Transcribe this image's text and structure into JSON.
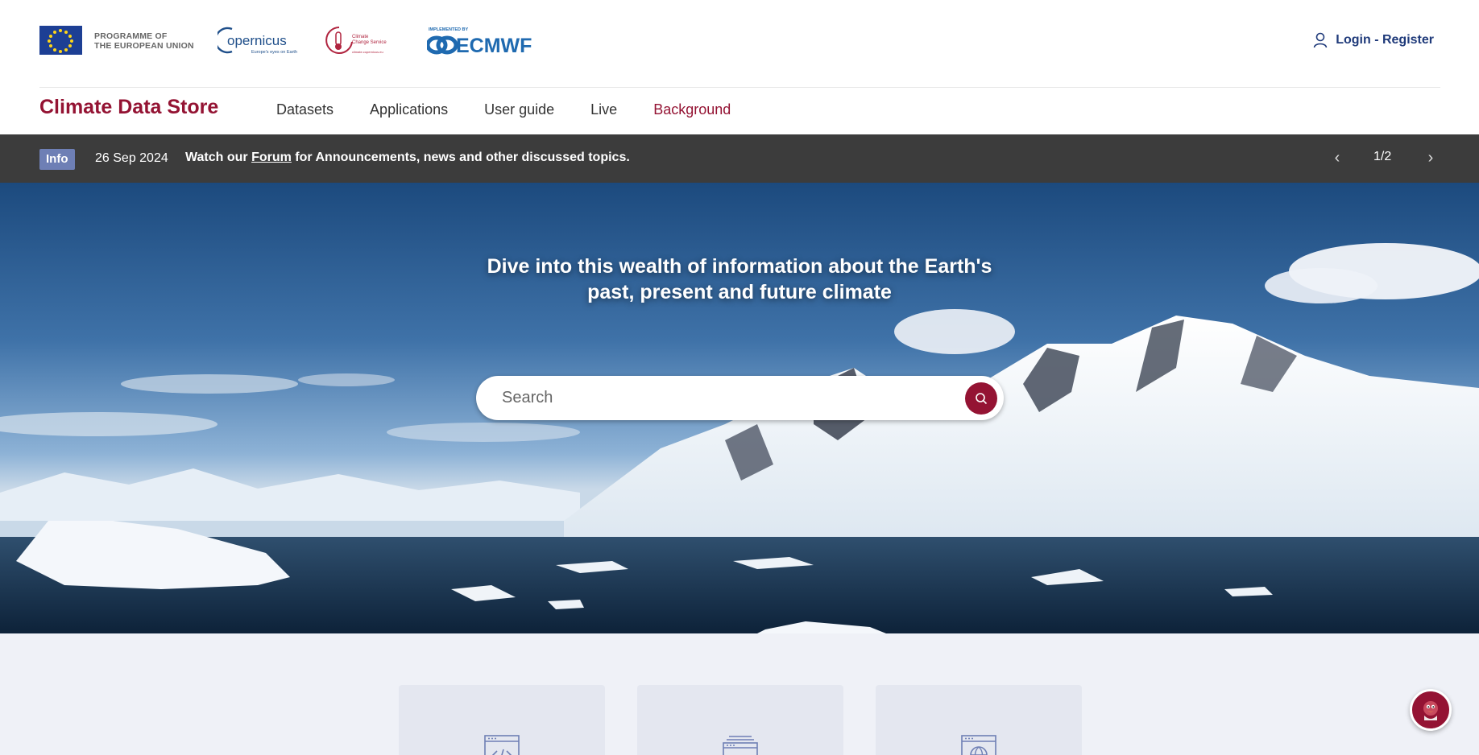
{
  "header": {
    "eu_text_line1": "PROGRAMME OF",
    "eu_text_line2": "THE EUROPEAN UNION",
    "copernicus_name": "opernicus",
    "copernicus_tagline": "Europe's eyes on Earth",
    "c3s_line1": "Climate",
    "c3s_line2": "Change Service",
    "c3s_url": "climate.copernicus.eu",
    "ecmwf_prefix": "IMPLEMENTED BY",
    "ecmwf_name": "ECMWF",
    "login_label": "Login - Register"
  },
  "nav": {
    "brand": "Climate Data Store",
    "items": [
      {
        "label": "Datasets"
      },
      {
        "label": "Applications"
      },
      {
        "label": "User guide"
      },
      {
        "label": "Live"
      },
      {
        "label": "Background"
      }
    ]
  },
  "info_banner": {
    "badge": "Info",
    "date": "26 Sep 2024",
    "msg_prefix": "Watch our ",
    "msg_link": "Forum",
    "msg_suffix": " for Announcements, news and other discussed topics.",
    "page": "1/2",
    "prev_icon": "chevron-left-icon",
    "next_icon": "chevron-right-icon"
  },
  "hero": {
    "title_line1": "Dive into this wealth of information about the Earth's",
    "title_line2": "past, present and future climate",
    "search_placeholder": "Search"
  },
  "cards": [
    {
      "icon": "code-window-icon"
    },
    {
      "icon": "stacked-windows-icon"
    },
    {
      "icon": "globe-window-icon"
    }
  ],
  "colors": {
    "brand": "#941333",
    "navy": "#1f3a7a",
    "info_bar": "#3c3c3c",
    "badge": "#6e7fb5"
  }
}
